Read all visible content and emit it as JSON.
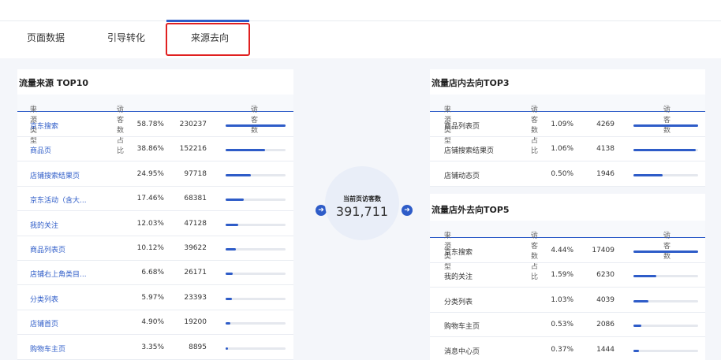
{
  "tabs": [
    {
      "label": "页面数据"
    },
    {
      "label": "引导转化"
    },
    {
      "label": "来源去向"
    }
  ],
  "left_panel": {
    "title": "流量来源 TOP10",
    "headers": {
      "type": "来源类型",
      "ratio": "访客数占比",
      "count": "访客数"
    },
    "rows": [
      {
        "name": "京东搜索",
        "pct": "58.78%",
        "count": "230237",
        "fill": 1.0
      },
      {
        "name": "商品页",
        "pct": "38.86%",
        "count": "152216",
        "fill": 0.661
      },
      {
        "name": "店铺搜索结果页",
        "pct": "24.95%",
        "count": "97718",
        "fill": 0.424
      },
      {
        "name": "京东活动（含大...",
        "pct": "17.46%",
        "count": "68381",
        "fill": 0.297
      },
      {
        "name": "我的关注",
        "pct": "12.03%",
        "count": "47128",
        "fill": 0.205
      },
      {
        "name": "商品列表页",
        "pct": "10.12%",
        "count": "39622",
        "fill": 0.172
      },
      {
        "name": "店铺右上角类目...",
        "pct": "6.68%",
        "count": "26171",
        "fill": 0.114
      },
      {
        "name": "分类列表",
        "pct": "5.97%",
        "count": "23393",
        "fill": 0.102
      },
      {
        "name": "店铺首页",
        "pct": "4.90%",
        "count": "19200",
        "fill": 0.083
      },
      {
        "name": "购物车主页",
        "pct": "3.35%",
        "count": "8895",
        "fill": 0.039
      }
    ]
  },
  "center": {
    "label": "当前页访客数",
    "value": "391,711"
  },
  "right_top": {
    "title": "流量店内去向TOP3",
    "headers": {
      "type": "来源类型",
      "ratio": "访客数占比",
      "count": "访客数"
    },
    "rows": [
      {
        "name": "商品列表页",
        "pct": "1.09%",
        "count": "4269",
        "fill": 1.0
      },
      {
        "name": "店铺搜索结果页",
        "pct": "1.06%",
        "count": "4138",
        "fill": 0.969
      },
      {
        "name": "店铺动态页",
        "pct": "0.50%",
        "count": "1946",
        "fill": 0.456
      }
    ]
  },
  "right_bottom": {
    "title": "流量店外去向TOP5",
    "headers": {
      "type": "来源类型",
      "ratio": "访客数占比",
      "count": "访客数"
    },
    "rows": [
      {
        "name": "京东搜索",
        "pct": "4.44%",
        "count": "17409",
        "fill": 1.0
      },
      {
        "name": "我的关注",
        "pct": "1.59%",
        "count": "6230",
        "fill": 0.358
      },
      {
        "name": "分类列表",
        "pct": "1.03%",
        "count": "4039",
        "fill": 0.232
      },
      {
        "name": "购物车主页",
        "pct": "0.53%",
        "count": "2086",
        "fill": 0.12
      },
      {
        "name": "消息中心页",
        "pct": "0.37%",
        "count": "1444",
        "fill": 0.083
      }
    ]
  },
  "icons": {
    "help": "help-circle-icon",
    "arrow": "arrow-right-circle-icon"
  },
  "colors": {
    "accent": "#2e5cc8",
    "highlight_box": "#e02020"
  }
}
